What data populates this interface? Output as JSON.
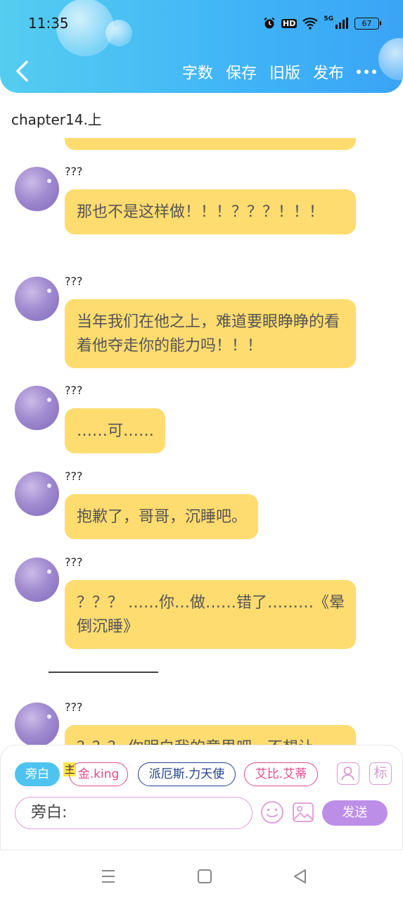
{
  "status_bar": {
    "time": "11:35",
    "hd": "HD",
    "network": "5G",
    "battery": "67"
  },
  "toolbar": {
    "actions": [
      "字数",
      "保存",
      "旧版",
      "发布"
    ]
  },
  "chapter": {
    "title": "chapter14.上"
  },
  "messages": [
    {
      "sender": "???",
      "text": "那也不是这样做！！！？？？！！！"
    },
    {
      "sender": "???",
      "text": "当年我们在他之上，难道要眼睁睁的看着他夺走你的能力吗！！！"
    },
    {
      "sender": "???",
      "text": "……可……"
    },
    {
      "sender": "???",
      "text": "抱歉了，哥哥，沉睡吧。"
    },
    {
      "sender": "???",
      "text": "？？？ ……你…做……错了………《晕倒沉睡》"
    },
    {
      "sender": "???",
      "text": "？？？ 你明白我的意思吧，不想让"
    }
  ],
  "separator_text": "————————",
  "panel": {
    "narrator_chip": "旁白",
    "main_mark": "主",
    "characters": [
      "金.king",
      "派厄斯.力天使",
      "艾比.艾蒂"
    ],
    "tag_button": "标",
    "input_value": "旁白:",
    "send_label": "发送"
  }
}
